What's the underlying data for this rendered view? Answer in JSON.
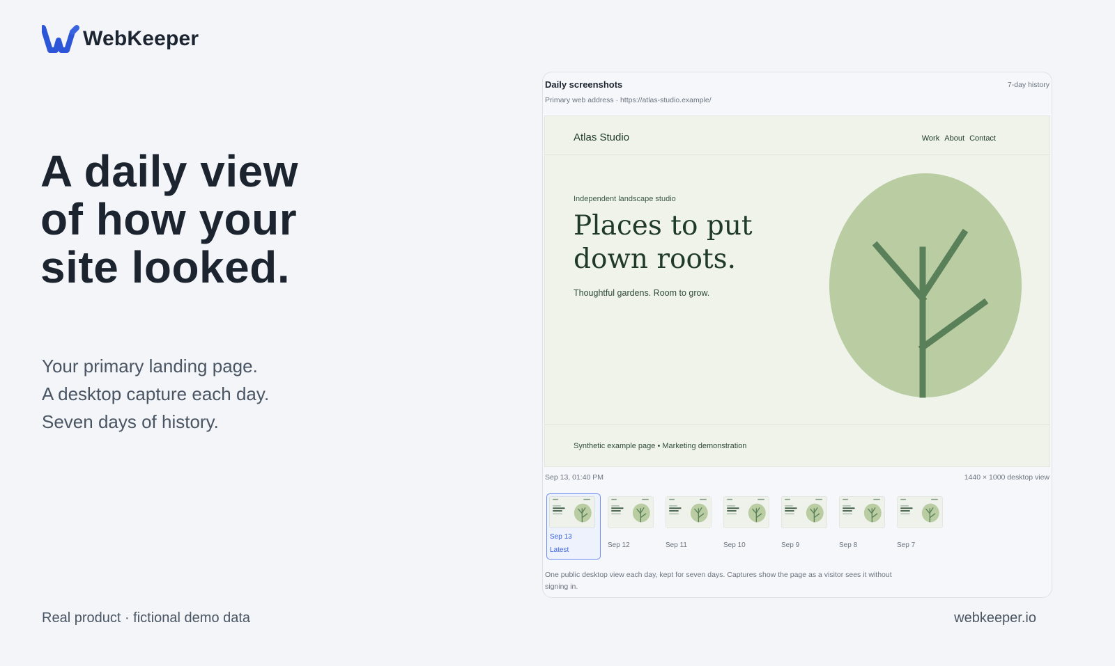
{
  "brand": {
    "name": "WebKeeper",
    "accent": "#3a63e0"
  },
  "hero": {
    "headline": [
      "A daily view",
      "of how your",
      "site looked."
    ],
    "subtext": [
      "Your primary landing page.",
      "A desktop capture each day.",
      "Seven days of history."
    ]
  },
  "footer": {
    "left": "Real product · fictional demo data",
    "right": "webkeeper.io"
  },
  "panel": {
    "title": "Daily screenshots",
    "history_label": "7-day history",
    "address": "Primary web address · https://atlas-studio.example/",
    "preview": {
      "brand": "Atlas Studio",
      "nav": [
        "Work",
        "About",
        "Contact"
      ],
      "eyebrow": "Independent landscape studio",
      "heading": [
        "Places to put",
        "down roots."
      ],
      "tagline": "Thoughtful gardens. Room to grow.",
      "footer": "Synthetic example page • Marketing demonstration",
      "colors": {
        "background": "#eff3ea",
        "circle": "#b9cca2",
        "tree": "#5a8059"
      }
    },
    "capture_time": "Sep 13, 01:40 PM",
    "viewport": "1440 × 1000 desktop view",
    "thumbnails": [
      {
        "label": "Sep 13",
        "badge": "Latest"
      },
      {
        "label": "Sep 12"
      },
      {
        "label": "Sep 11"
      },
      {
        "label": "Sep 10"
      },
      {
        "label": "Sep 9"
      },
      {
        "label": "Sep 8"
      },
      {
        "label": "Sep 7"
      }
    ],
    "note": "One public desktop view each day, kept for seven days. Captures show the page as a visitor sees it without signing in."
  }
}
